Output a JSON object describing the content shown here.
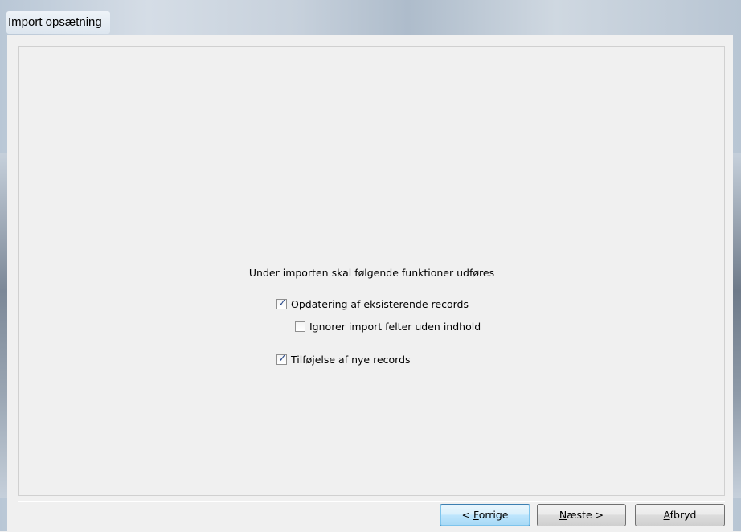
{
  "window": {
    "title": "Import opsætning"
  },
  "content": {
    "heading": "Under importen skal følgende funktioner udføres",
    "options": [
      {
        "label": "Opdatering af eksisterende records",
        "checked": true
      },
      {
        "label": "Ignorer import felter uden indhold",
        "checked": false
      },
      {
        "label": "Tilføjelse af nye records",
        "checked": true
      }
    ]
  },
  "buttons": {
    "back": {
      "prefix": "< ",
      "mnemonic": "F",
      "rest": "orrige"
    },
    "next": {
      "mnemonic": "N",
      "rest": "æste >"
    },
    "cancel": {
      "mnemonic": "A",
      "rest": "fbryd"
    }
  }
}
